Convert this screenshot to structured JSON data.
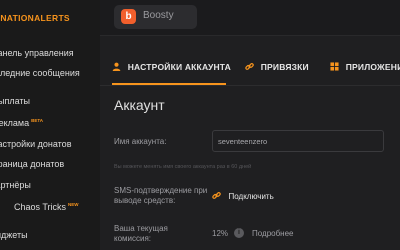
{
  "sidebar": {
    "logo": "DONATIONALERTS",
    "items": [
      {
        "label": "Панель управления"
      },
      {
        "label": "Последние сообщения"
      },
      {
        "label": "Выплаты"
      },
      {
        "label": "Реклама",
        "tag": "BETA"
      },
      {
        "label": "Настройки донатов"
      },
      {
        "label": "Страница донатов"
      },
      {
        "label": "Партнёры"
      },
      {
        "label": "Chaos Tricks",
        "tag": "NEW"
      },
      {
        "label": "Виджеты"
      }
    ]
  },
  "topbar": {
    "boosty_label": "Boosty",
    "boosty_icon": "b"
  },
  "tabs": [
    {
      "label": "НАСТРОЙКИ АККАУНТА",
      "icon": "user-icon",
      "active": true
    },
    {
      "label": "ПРИВЯЗКИ",
      "icon": "link-icon"
    },
    {
      "label": "ПРИЛОЖЕНИЯ",
      "icon": "apps-icon"
    }
  ],
  "section": {
    "title": "Аккаунт",
    "account_name_label": "Имя аккаунта:",
    "account_name_value": "seventeenzero",
    "account_name_hint": "Вы можете менять имя своего аккаунта раз в 60 дней",
    "sms_label": "SMS-подтверждение при выводе средств:",
    "sms_action": "Подключить",
    "commission_label": "Ваша текущая комиссия:",
    "commission_value": "12%",
    "commission_more": "Подробнее"
  },
  "colors": {
    "accent": "#f7941d",
    "boosty": "#f15f2c",
    "background": "#1f1f21"
  }
}
